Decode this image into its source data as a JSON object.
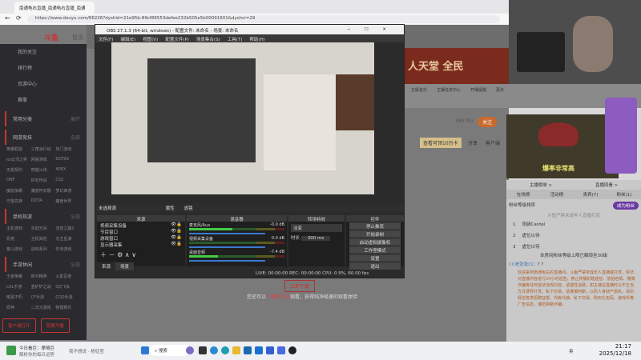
{
  "browser": {
    "tab_title": "南通龟右直播_南通龟右直播_南通",
    "url": "https://www.douyu.com/66226?dyshid=21e95b-89cf86553defee232b505e5b00091601&dyshci=29"
  },
  "site": {
    "logo": "斗鱼",
    "home": "首页",
    "banner": "人天堂 全民",
    "sidebar": [
      "我的关注",
      "排行榜",
      "页游中心",
      "赛事"
    ],
    "common": "常用分类",
    "common_more": "展开",
    "sections": [
      {
        "title": "网游竞技",
        "more": "全部",
        "items": [
          "英雄联盟",
          "三角洲行动",
          "热门游戏",
          "lol云顶之弈",
          "网易游戏",
          "DOTA2",
          "无畏契约",
          "穿越火线",
          "APEX",
          "DNF",
          "炉石传说",
          "CS2",
          "魔兽争霸",
          "魔兽怀旧服",
          "梦幻西游",
          "守望先锋",
          "DOTA",
          "魔兽世界"
        ]
      },
      {
        "title": "单机热游",
        "more": "全部",
        "items": [
          "主机游戏",
          "永劫无间",
          "流放之路2",
          "饥荒",
          "主机其他",
          "无主星渊",
          "格斗游戏",
          "战地系列",
          "怀旧游戏"
        ]
      },
      {
        "title": "手游休闲",
        "more": "全部",
        "items": [
          "王者荣耀",
          "和平精英",
          "火影忍者",
          "LOL手游",
          "金铲铲之战",
          "QQ飞车",
          "暗黑不朽",
          "CF手游",
          "COD手游",
          "原神",
          "二次元游戏",
          "物理娱乐"
        ]
      }
    ],
    "btn_client": "客户端打开",
    "btn_live": "我要开播",
    "icons_row": [
      "正版音乐",
      "主播任务中心",
      "开播提醒",
      "更多"
    ],
    "follow_count": "384783",
    "follow": "关注",
    "share": "分享",
    "client": "客户端",
    "promo": "查看可领10万卡",
    "game_text": "爆率非常高",
    "bottom_note_pre": "您还可以",
    "bottom_note_link": "下载客户端",
    "bottom_note_post": "观看，获得纯净极速的观看体验",
    "download_btn": "立即下载"
  },
  "rpanel": {
    "rank_link": "主播榜单 >",
    "replay_link": "直播回看 >",
    "tabs": [
      "在线榜",
      "活动榜",
      "贵宾(7)",
      "粉丝(1)"
    ],
    "fan_title": "粉丝等级排序",
    "join": "成为粉丝",
    "notice": "斗鱼严禁未成年人直播打赏",
    "fans": [
      {
        "rank": "1",
        "name": "雨骑Cantel"
      },
      {
        "rank": "2",
        "name": "虚位以待"
      },
      {
        "rank": "3",
        "name": "虚位以待"
      }
    ],
    "limit": "本房间粉丝等级上限已解锁至30级",
    "chat_user": "CC老张张CC:",
    "chat_msg": "? ?",
    "system": "欢迎来到南通龟右的直播间。斗鱼严禁未成年人直播或打赏，依法对直播内容进行24小时巡查，禁止传播封建迷信、低俗色情、赌博诈骗等任何违法违规内容，请理性消费，如主播在直播时以不正当方式诱导打赏，私下交易，请谨慎判断，以防人身财产损失。请勿轻信各类招聘征婚、代练代抽、私下交易、购买礼包码、游戏币等广告信息，谨防网络诈骗。"
  },
  "obs": {
    "title": "OBS 27.1.3 (64-bit, windows) - 配置文件: 未命名 - 场景: 未命名",
    "menu": [
      "文件(F)",
      "编辑(E)",
      "视图(V)",
      "配置文件(P)",
      "场景集合(S)",
      "工具(T)",
      "帮助(H)"
    ],
    "no_source": "未选择源",
    "properties": "属性",
    "filters": "滤镜",
    "docks": {
      "sources": "来源",
      "mixer": "混音器",
      "transitions": "转场特效",
      "controls": "控件"
    },
    "sources": [
      "视频采集设备",
      "节目窗口",
      "游戏窗口",
      "显示器采集"
    ],
    "tabs": [
      "来源",
      "场景"
    ],
    "mixer": [
      {
        "name": "麦克风/Aux",
        "db": "-0.0 dB",
        "level": 0.45
      },
      {
        "name": "视频采集设备",
        "db": "0.0 dB",
        "level": 0
      },
      {
        "name": "桌面音频",
        "db": "-7.4 dB",
        "level": 0.3
      }
    ],
    "transition": "淡变",
    "duration_label": "时长",
    "duration": "300 ms",
    "controls": [
      "停止推流",
      "开始录制",
      "启动虚拟摄像机",
      "工作室模式",
      "设置",
      "退出"
    ],
    "status": "LIVE: 00:00:00   REC: 00:00:00   CPU: 0.9%, 60.00 fps"
  },
  "taskbar": {
    "news_title": "今日看巨：摩嘻巨",
    "news_sub": "解析你的每日运势",
    "pinned": "我不想说 · 杨钰莹",
    "search": "搜索",
    "tray_lang": "英",
    "time": "21:17",
    "date": "2025/12/18"
  }
}
